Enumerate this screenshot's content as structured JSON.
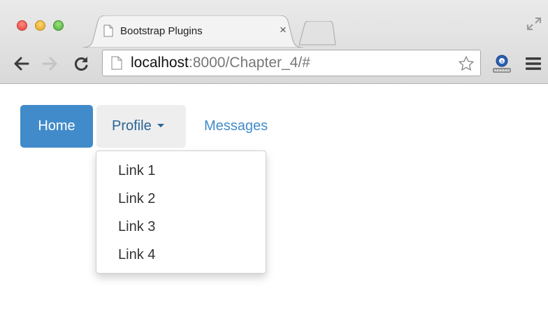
{
  "browser": {
    "tab": {
      "title": "Bootstrap Plugins",
      "close": "×"
    },
    "address_bar": {
      "host": "localhost",
      "rest": ":8000/Chapter_4/#"
    },
    "icons": {
      "close_window": "close-window-icon",
      "minimize_window": "minimize-window-icon",
      "zoom_window": "zoom-window-icon",
      "back": "back-arrow-icon",
      "forward": "forward-arrow-icon",
      "reload": "reload-icon",
      "bookmark": "star-icon",
      "extension": "extension-icon",
      "menu": "hamburger-menu-icon",
      "fullscreen": "fullscreen-icon"
    }
  },
  "nav": {
    "home": "Home",
    "profile": "Profile",
    "messages": "Messages"
  },
  "dropdown": {
    "items": [
      "Link 1",
      "Link 2",
      "Link 3",
      "Link 4"
    ]
  },
  "colors": {
    "primary": "#428bca",
    "active_pill_text": "#2a6496",
    "pill_hover_bg": "#eeeeee"
  }
}
